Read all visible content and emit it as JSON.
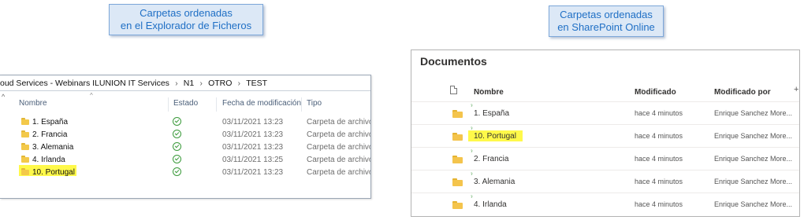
{
  "callouts": {
    "left": {
      "line1": "Carpetas ordenadas",
      "line2": "en el Explorador de Ficheros"
    },
    "right": {
      "line1": "Carpetas ordenadas",
      "line2": "en SharePoint Online"
    }
  },
  "explorer": {
    "breadcrumb": [
      "oud Services - Webinars ILUNION IT Services",
      "N1",
      "OTRO",
      "TEST"
    ],
    "columns": {
      "name": "Nombre",
      "status": "Estado",
      "date": "Fecha de modificación",
      "type": "Tipo"
    },
    "rows": [
      {
        "name": "1. España",
        "date": "03/11/2021 13:23",
        "type": "Carpeta de archivos"
      },
      {
        "name": "2. Francia",
        "date": "03/11/2021 13:23",
        "type": "Carpeta de archivos"
      },
      {
        "name": "3. Alemania",
        "date": "03/11/2021 13:23",
        "type": "Carpeta de archivos"
      },
      {
        "name": "4. Irlanda",
        "date": "03/11/2021 13:25",
        "type": "Carpeta de archivos"
      },
      {
        "name": "10. Portugal",
        "date": "03/11/2021 13:23",
        "type": "Carpeta de archivos"
      }
    ],
    "highlight_color": "#fff94a"
  },
  "sharepoint": {
    "title": "Documentos",
    "columns": {
      "name": "Nombre",
      "modified": "Modificado",
      "modified_by": "Modificado por"
    },
    "rows": [
      {
        "name": "1. España",
        "modified": "hace 4 minutos",
        "modified_by": "Enrique Sanchez More..."
      },
      {
        "name": "10. Portugal",
        "modified": "hace 4 minutos",
        "modified_by": "Enrique Sanchez More..."
      },
      {
        "name": "2. Francia",
        "modified": "hace 4 minutos",
        "modified_by": "Enrique Sanchez More..."
      },
      {
        "name": "3. Alemania",
        "modified": "hace 4 minutos",
        "modified_by": "Enrique Sanchez More..."
      },
      {
        "name": "4. Irlanda",
        "modified": "hace 4 minutos",
        "modified_by": "Enrique Sanchez More..."
      }
    ],
    "highlight_color": "#fff94a"
  },
  "colors": {
    "callout_bg": "#dce8f6",
    "callout_text": "#1f6fc5",
    "folder": "#f3c94a",
    "status_ok": "#3a9a3a"
  }
}
